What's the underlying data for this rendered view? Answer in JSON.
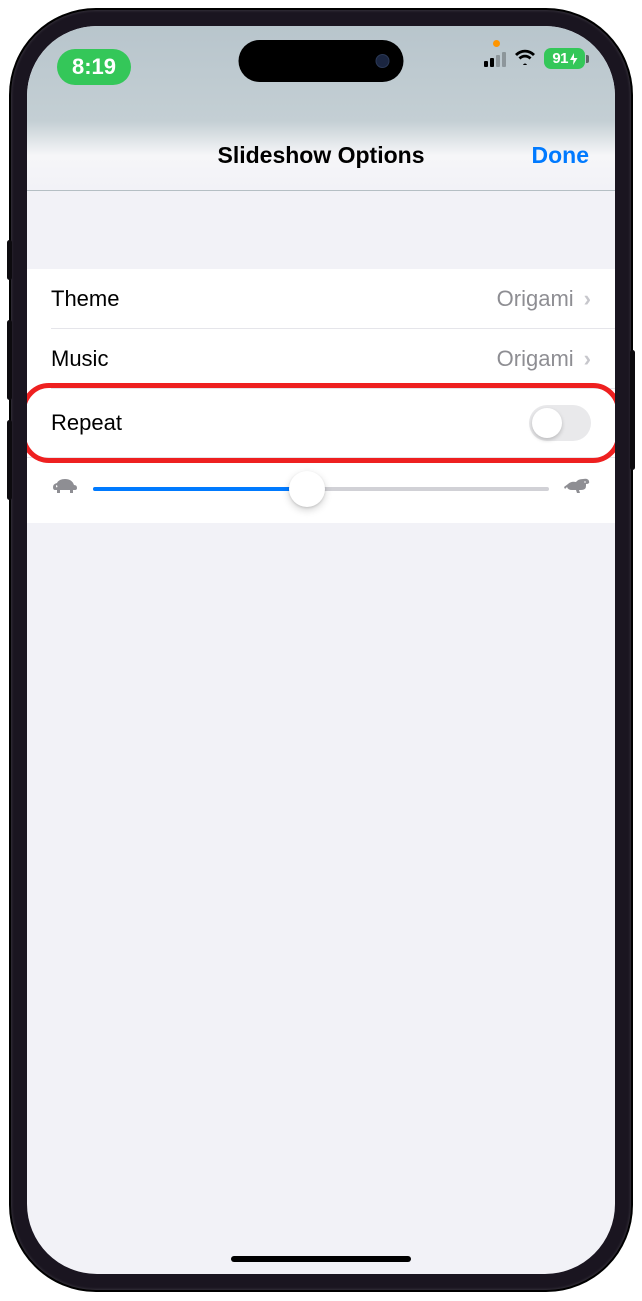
{
  "status": {
    "time": "8:19",
    "battery": "91"
  },
  "nav": {
    "title": "Slideshow Options",
    "done": "Done"
  },
  "rows": {
    "theme": {
      "label": "Theme",
      "value": "Origami"
    },
    "music": {
      "label": "Music",
      "value": "Origami"
    },
    "repeat": {
      "label": "Repeat"
    }
  },
  "slider": {
    "value_percent": 47
  }
}
